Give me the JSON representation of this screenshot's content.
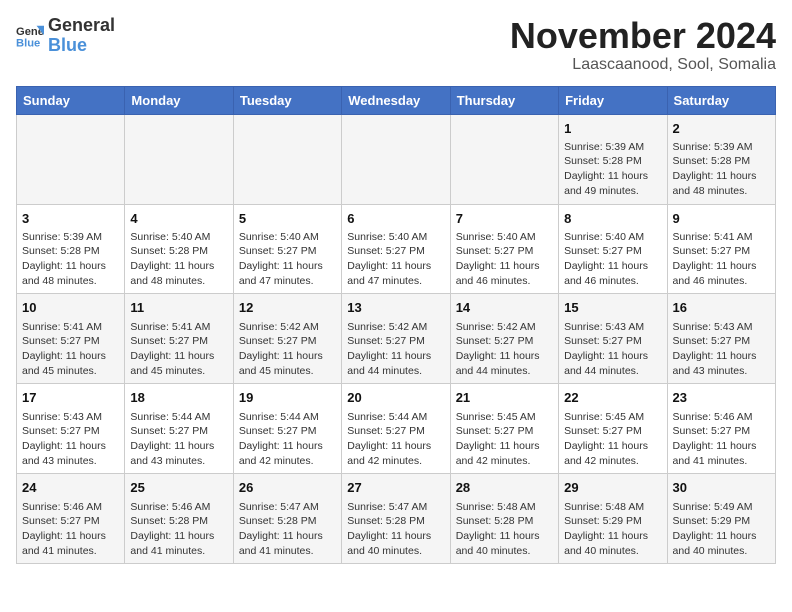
{
  "header": {
    "logo_general": "General",
    "logo_blue": "Blue",
    "title": "November 2024",
    "subtitle": "Laascaanood, Sool, Somalia"
  },
  "columns": [
    "Sunday",
    "Monday",
    "Tuesday",
    "Wednesday",
    "Thursday",
    "Friday",
    "Saturday"
  ],
  "weeks": [
    [
      {
        "day": "",
        "info": ""
      },
      {
        "day": "",
        "info": ""
      },
      {
        "day": "",
        "info": ""
      },
      {
        "day": "",
        "info": ""
      },
      {
        "day": "",
        "info": ""
      },
      {
        "day": "1",
        "info": "Sunrise: 5:39 AM\nSunset: 5:28 PM\nDaylight: 11 hours and 49 minutes."
      },
      {
        "day": "2",
        "info": "Sunrise: 5:39 AM\nSunset: 5:28 PM\nDaylight: 11 hours and 48 minutes."
      }
    ],
    [
      {
        "day": "3",
        "info": "Sunrise: 5:39 AM\nSunset: 5:28 PM\nDaylight: 11 hours and 48 minutes."
      },
      {
        "day": "4",
        "info": "Sunrise: 5:40 AM\nSunset: 5:28 PM\nDaylight: 11 hours and 48 minutes."
      },
      {
        "day": "5",
        "info": "Sunrise: 5:40 AM\nSunset: 5:27 PM\nDaylight: 11 hours and 47 minutes."
      },
      {
        "day": "6",
        "info": "Sunrise: 5:40 AM\nSunset: 5:27 PM\nDaylight: 11 hours and 47 minutes."
      },
      {
        "day": "7",
        "info": "Sunrise: 5:40 AM\nSunset: 5:27 PM\nDaylight: 11 hours and 46 minutes."
      },
      {
        "day": "8",
        "info": "Sunrise: 5:40 AM\nSunset: 5:27 PM\nDaylight: 11 hours and 46 minutes."
      },
      {
        "day": "9",
        "info": "Sunrise: 5:41 AM\nSunset: 5:27 PM\nDaylight: 11 hours and 46 minutes."
      }
    ],
    [
      {
        "day": "10",
        "info": "Sunrise: 5:41 AM\nSunset: 5:27 PM\nDaylight: 11 hours and 45 minutes."
      },
      {
        "day": "11",
        "info": "Sunrise: 5:41 AM\nSunset: 5:27 PM\nDaylight: 11 hours and 45 minutes."
      },
      {
        "day": "12",
        "info": "Sunrise: 5:42 AM\nSunset: 5:27 PM\nDaylight: 11 hours and 45 minutes."
      },
      {
        "day": "13",
        "info": "Sunrise: 5:42 AM\nSunset: 5:27 PM\nDaylight: 11 hours and 44 minutes."
      },
      {
        "day": "14",
        "info": "Sunrise: 5:42 AM\nSunset: 5:27 PM\nDaylight: 11 hours and 44 minutes."
      },
      {
        "day": "15",
        "info": "Sunrise: 5:43 AM\nSunset: 5:27 PM\nDaylight: 11 hours and 44 minutes."
      },
      {
        "day": "16",
        "info": "Sunrise: 5:43 AM\nSunset: 5:27 PM\nDaylight: 11 hours and 43 minutes."
      }
    ],
    [
      {
        "day": "17",
        "info": "Sunrise: 5:43 AM\nSunset: 5:27 PM\nDaylight: 11 hours and 43 minutes."
      },
      {
        "day": "18",
        "info": "Sunrise: 5:44 AM\nSunset: 5:27 PM\nDaylight: 11 hours and 43 minutes."
      },
      {
        "day": "19",
        "info": "Sunrise: 5:44 AM\nSunset: 5:27 PM\nDaylight: 11 hours and 42 minutes."
      },
      {
        "day": "20",
        "info": "Sunrise: 5:44 AM\nSunset: 5:27 PM\nDaylight: 11 hours and 42 minutes."
      },
      {
        "day": "21",
        "info": "Sunrise: 5:45 AM\nSunset: 5:27 PM\nDaylight: 11 hours and 42 minutes."
      },
      {
        "day": "22",
        "info": "Sunrise: 5:45 AM\nSunset: 5:27 PM\nDaylight: 11 hours and 42 minutes."
      },
      {
        "day": "23",
        "info": "Sunrise: 5:46 AM\nSunset: 5:27 PM\nDaylight: 11 hours and 41 minutes."
      }
    ],
    [
      {
        "day": "24",
        "info": "Sunrise: 5:46 AM\nSunset: 5:27 PM\nDaylight: 11 hours and 41 minutes."
      },
      {
        "day": "25",
        "info": "Sunrise: 5:46 AM\nSunset: 5:28 PM\nDaylight: 11 hours and 41 minutes."
      },
      {
        "day": "26",
        "info": "Sunrise: 5:47 AM\nSunset: 5:28 PM\nDaylight: 11 hours and 41 minutes."
      },
      {
        "day": "27",
        "info": "Sunrise: 5:47 AM\nSunset: 5:28 PM\nDaylight: 11 hours and 40 minutes."
      },
      {
        "day": "28",
        "info": "Sunrise: 5:48 AM\nSunset: 5:28 PM\nDaylight: 11 hours and 40 minutes."
      },
      {
        "day": "29",
        "info": "Sunrise: 5:48 AM\nSunset: 5:29 PM\nDaylight: 11 hours and 40 minutes."
      },
      {
        "day": "30",
        "info": "Sunrise: 5:49 AM\nSunset: 5:29 PM\nDaylight: 11 hours and 40 minutes."
      }
    ]
  ]
}
